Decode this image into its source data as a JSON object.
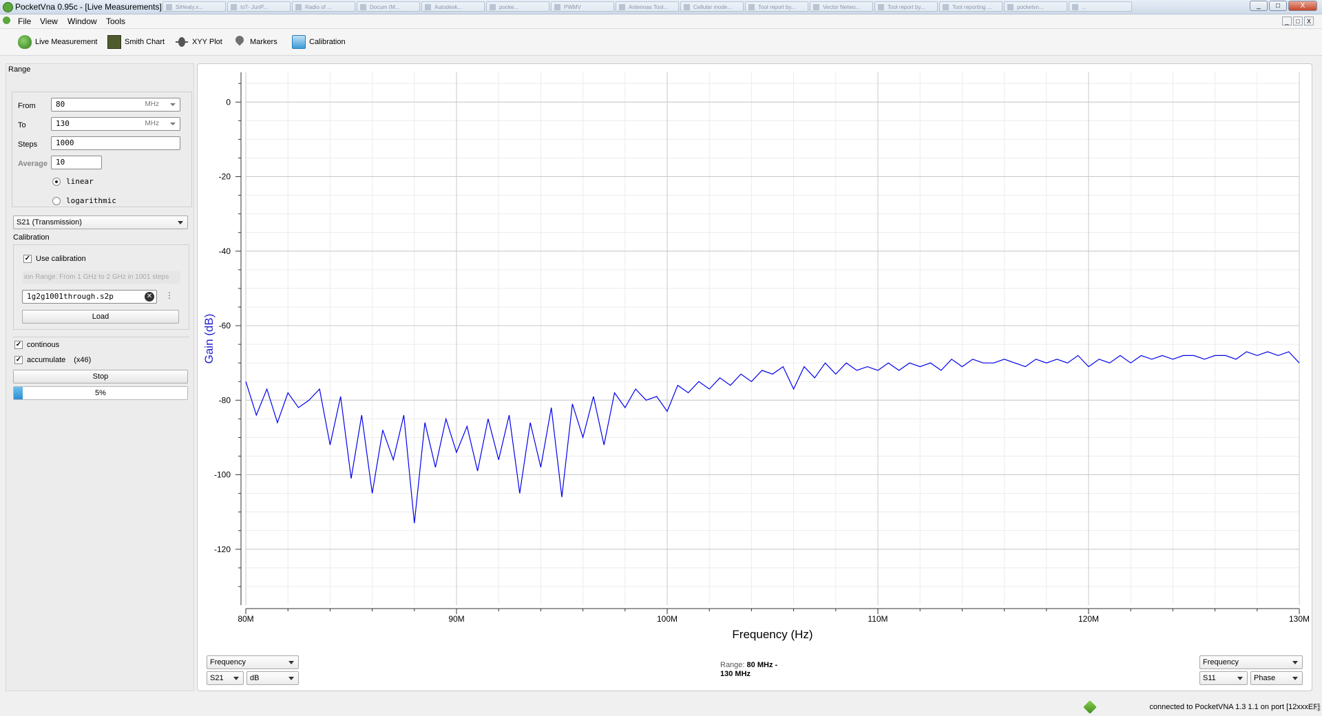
{
  "window": {
    "title": "PocketVna 0.95c - [Live Measurements]",
    "taskbar_tabs": [
      "SiHealy.x...",
      "IoT- JunP...",
      "Radio of ...",
      "Docum (M...",
      "Autodesk...",
      "pocke...",
      "PWMV",
      "Antennas Tool...",
      "Cellular mode...",
      "Tool report by...",
      "Vector Netwo...",
      "Tool report by...",
      "Tool reporting ...",
      "pocketvn...",
      "..."
    ],
    "min_label": "_",
    "max_label": "□",
    "close_label": "X"
  },
  "menu": {
    "items": [
      "File",
      "View",
      "Window",
      "Tools"
    ]
  },
  "toolbar": {
    "live": "Live Measurement",
    "smith": "Smith Chart",
    "xyy": "XYY Plot",
    "markers": "Markers",
    "calibration": "Calibration"
  },
  "range": {
    "title": "Range",
    "from_label": "From",
    "from_value": "80",
    "from_unit": "MHz",
    "to_label": "To",
    "to_value": "130",
    "to_unit": "MHz",
    "steps_label": "Steps",
    "steps_value": "1000",
    "average_label": "Average",
    "average_value": "10",
    "linear": "linear",
    "logarithmic": "logarithmic"
  },
  "param_select": "S21 (Transmission)",
  "calibration": {
    "title": "Calibration",
    "use_label": "Use calibration",
    "range_info": "ion Range: From 1 GHz to 2 GHz in 1001 steps",
    "file": "1g2g1001through.s2p",
    "load": "Load"
  },
  "options": {
    "continuous": "continous",
    "accumulate": "accumulate",
    "accumulate_count": "(x46)",
    "stop": "Stop",
    "progress": 0.05,
    "progress_text": "5%"
  },
  "bottom": {
    "left_x": "Frequency",
    "left_param": "S21",
    "left_unit": "dB",
    "range_label": "Range:",
    "range_value_1": "80 MHz -",
    "range_value_2": "130 MHz",
    "right_x": "Frequency",
    "right_param": "S11",
    "right_unit": "Phase"
  },
  "status": "connected to PocketVNA 1.3 1.1 on port [12xxxEF]",
  "colors": {
    "trace": "#0000ee",
    "axis_label": "#2222cc",
    "grid": "#d9d9d9"
  },
  "chart_data": {
    "type": "line",
    "title": "",
    "xlabel": "Frequency (Hz)",
    "ylabel": "Gain (dB)",
    "xlim": [
      80,
      130
    ],
    "ylim": [
      -135,
      8
    ],
    "x_ticks": [
      "80M",
      "90M",
      "100M",
      "110M",
      "120M",
      "130M"
    ],
    "x_tick_values": [
      80,
      90,
      100,
      110,
      120,
      130
    ],
    "y_ticks": [
      "0",
      "-20",
      "-40",
      "-60",
      "-80",
      "-100",
      "-120"
    ],
    "y_tick_values": [
      0,
      -20,
      -40,
      -60,
      -80,
      -100,
      -120
    ],
    "grid": true,
    "series": [
      {
        "x": [
          80,
          80.5,
          81,
          81.5,
          82,
          82.5,
          83,
          83.5,
          84,
          84.5,
          85,
          85.5,
          86,
          86.5,
          87,
          87.5,
          88,
          88.5,
          89,
          89.5,
          90,
          90.5,
          91,
          91.5,
          92,
          92.5,
          93,
          93.5,
          94,
          94.5,
          95,
          95.5,
          96,
          96.5,
          97,
          97.5,
          98,
          98.5,
          99,
          99.5,
          100,
          100.5,
          101,
          101.5,
          102,
          102.5,
          103,
          103.5,
          104,
          104.5,
          105,
          105.5,
          106,
          106.5,
          107,
          107.5,
          108,
          108.5,
          109,
          109.5,
          110,
          110.5,
          111,
          111.5,
          112,
          112.5,
          113,
          113.5,
          114,
          114.5,
          115,
          115.5,
          116,
          116.5,
          117,
          117.5,
          118,
          118.5,
          119,
          119.5,
          120,
          120.5,
          121,
          121.5,
          122,
          122.5,
          123,
          123.5,
          124,
          124.5,
          125,
          125.5,
          126,
          126.5,
          127,
          127.5,
          128,
          128.5,
          129,
          129.5,
          130
        ],
        "values": [
          -75,
          -84,
          -77,
          -86,
          -78,
          -82,
          -80,
          -77,
          -92,
          -79,
          -101,
          -84,
          -105,
          -88,
          -96,
          -84,
          -113,
          -86,
          -98,
          -85,
          -94,
          -87,
          -99,
          -85,
          -96,
          -84,
          -105,
          -86,
          -98,
          -82,
          -106,
          -81,
          -90,
          -79,
          -92,
          -78,
          -82,
          -77,
          -80,
          -79,
          -83,
          -76,
          -78,
          -75,
          -77,
          -74,
          -76,
          -73,
          -75,
          -72,
          -73,
          -71,
          -77,
          -71,
          -74,
          -70,
          -73,
          -70,
          -72,
          -71,
          -72,
          -70,
          -72,
          -70,
          -71,
          -70,
          -72,
          -69,
          -71,
          -69,
          -70,
          -70,
          -69,
          -70,
          -71,
          -69,
          -70,
          -69,
          -70,
          -68,
          -71,
          -69,
          -70,
          -68,
          -70,
          -68,
          -69,
          -68,
          -69,
          -68,
          -68,
          -69,
          -68,
          -68,
          -69,
          -67,
          -68,
          -67,
          -68,
          -67,
          -70
        ]
      }
    ]
  }
}
